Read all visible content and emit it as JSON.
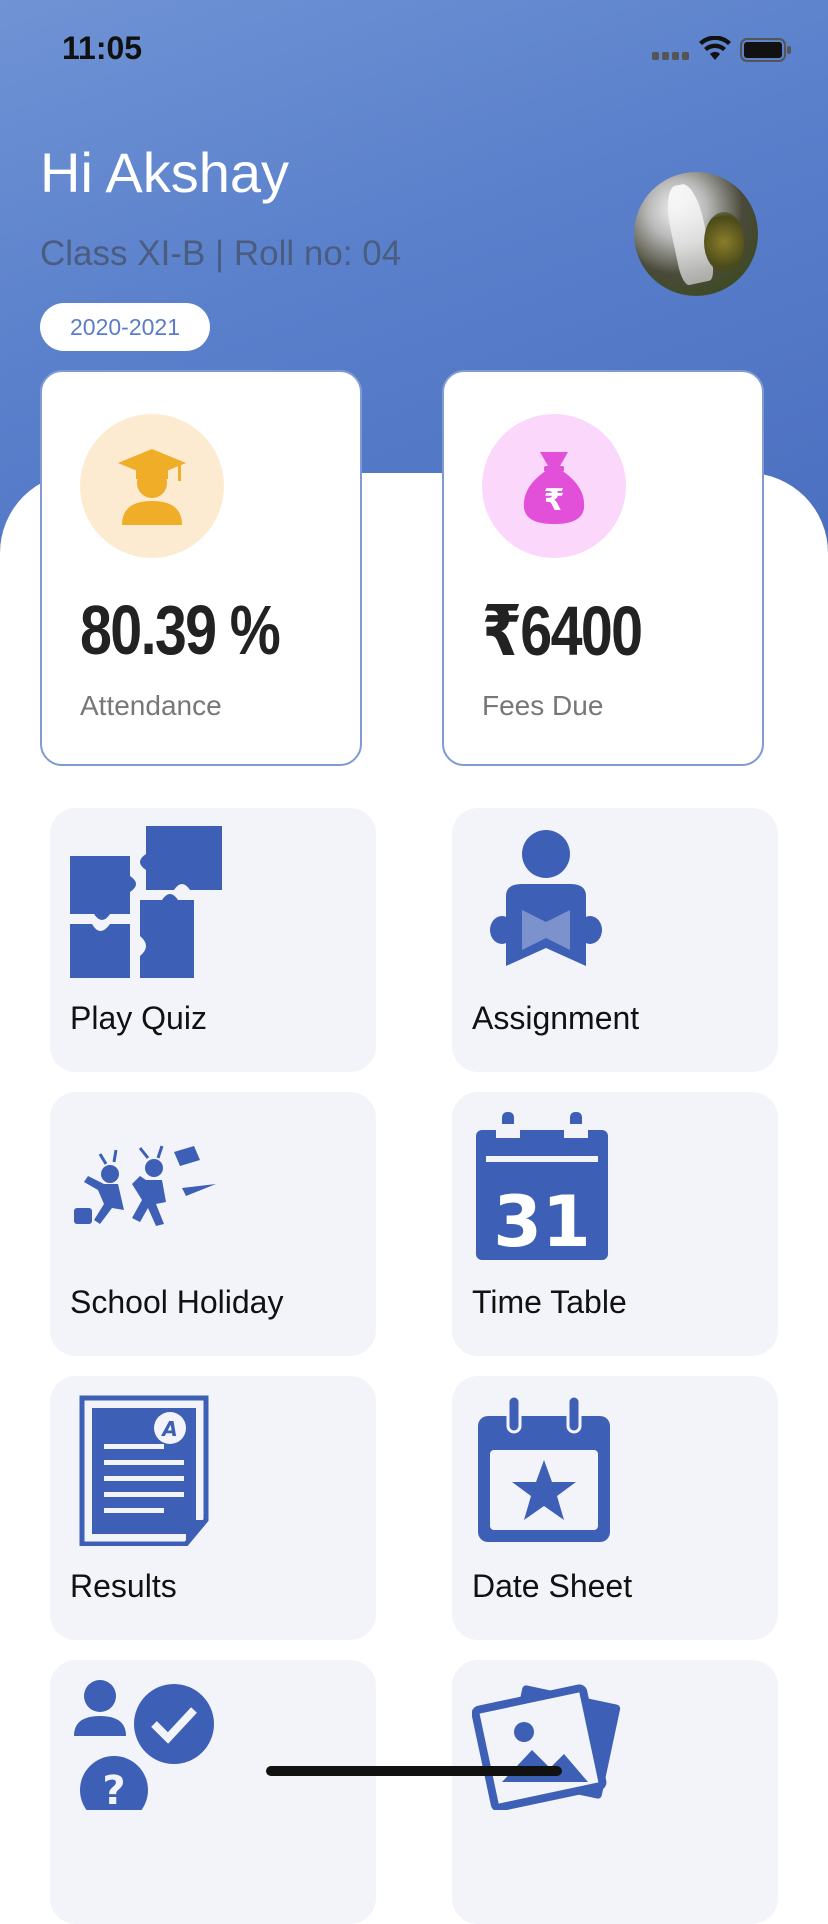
{
  "status_bar": {
    "time": "11:05"
  },
  "header": {
    "greeting": "Hi Akshay",
    "class_info": "Class XI-B | Roll no: 04",
    "session": "2020-2021"
  },
  "stats": [
    {
      "value": "80.39 %",
      "label": "Attendance",
      "icon": "graduate-icon",
      "icon_bg": "#fcebd0",
      "icon_color": "#efad28"
    },
    {
      "value": "₹6400",
      "label": "Fees Due",
      "icon": "money-bag-icon",
      "icon_bg": "#fbd7fb",
      "icon_color": "#e24fd8"
    }
  ],
  "tiles": [
    {
      "label": "Play Quiz",
      "icon": "puzzle-icon"
    },
    {
      "label": "Assignment",
      "icon": "reading-person-icon"
    },
    {
      "label": "School Holiday",
      "icon": "celebrating-kids-icon"
    },
    {
      "label": "Time Table",
      "icon": "calendar-31-icon"
    },
    {
      "label": "Results",
      "icon": "report-card-icon"
    },
    {
      "label": "Date Sheet",
      "icon": "calendar-star-icon"
    },
    {
      "label": "",
      "icon": "question-check-icon"
    },
    {
      "label": "",
      "icon": "photo-gallery-icon"
    }
  ],
  "colors": {
    "accent": "#3d5fb5",
    "header_start": "#6f93d4",
    "header_end": "#4b6fbf",
    "tile_bg": "#f3f4fa"
  }
}
